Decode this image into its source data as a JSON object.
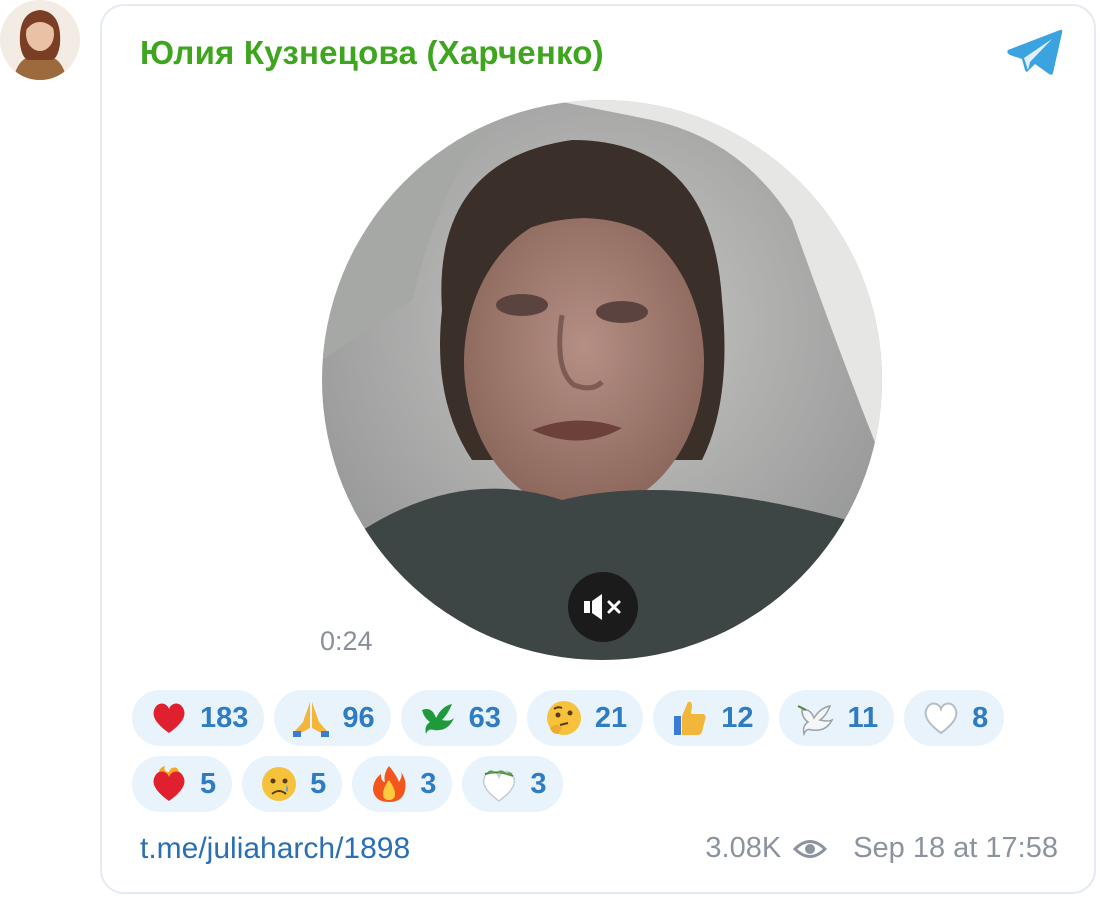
{
  "post": {
    "author": "Юлия Кузнецова (Харченко)",
    "video": {
      "duration": "0:24",
      "muted": true
    },
    "reactions": [
      {
        "emoji": "heart-emoji",
        "count": "183"
      },
      {
        "emoji": "praying-hands-emoji",
        "count": "96"
      },
      {
        "emoji": "green-dove-emoji",
        "count": "63"
      },
      {
        "emoji": "thinking-face-emoji",
        "count": "21"
      },
      {
        "emoji": "thumbs-up-emoji",
        "count": "12"
      },
      {
        "emoji": "dove-emoji",
        "count": "11"
      },
      {
        "emoji": "white-heart-emoji",
        "count": "8"
      },
      {
        "emoji": "heart-on-fire-emoji",
        "count": "5"
      },
      {
        "emoji": "crying-face-emoji",
        "count": "5"
      },
      {
        "emoji": "fire-emoji",
        "count": "3"
      },
      {
        "emoji": "heart-with-olive-branch-emoji",
        "count": "3"
      }
    ],
    "link": "t.me/juliaharch/1898",
    "views": "3.08K",
    "date": "Sep 18 at 17:58"
  },
  "colors": {
    "author": "#3ea51e",
    "reaction_bg": "#e8f3fc",
    "reaction_text": "#2e7cc2",
    "link": "#2a6fb4",
    "meta": "#8b949e"
  }
}
